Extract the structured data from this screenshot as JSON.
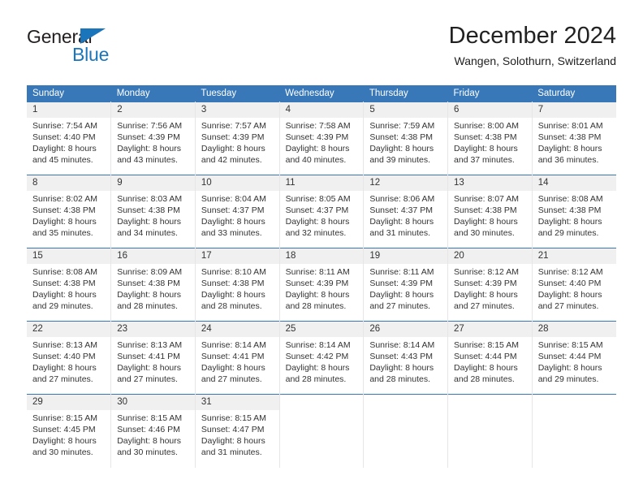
{
  "brand": {
    "name_dark": "General",
    "name_blue": "Blue",
    "accent_color": "#1b75bb"
  },
  "header": {
    "title": "December 2024",
    "subtitle": "Wangen, Solothurn, Switzerland"
  },
  "theme": {
    "header_row_color": "#3878b8",
    "daynum_band_color": "#f0f0f0",
    "text_color": "#333333"
  },
  "weekday_headers": [
    "Sunday",
    "Monday",
    "Tuesday",
    "Wednesday",
    "Thursday",
    "Friday",
    "Saturday"
  ],
  "weeks": [
    [
      {
        "day": "1",
        "sunrise": "Sunrise: 7:54 AM",
        "sunset": "Sunset: 4:40 PM",
        "daylight1": "Daylight: 8 hours",
        "daylight2": "and 45 minutes."
      },
      {
        "day": "2",
        "sunrise": "Sunrise: 7:56 AM",
        "sunset": "Sunset: 4:39 PM",
        "daylight1": "Daylight: 8 hours",
        "daylight2": "and 43 minutes."
      },
      {
        "day": "3",
        "sunrise": "Sunrise: 7:57 AM",
        "sunset": "Sunset: 4:39 PM",
        "daylight1": "Daylight: 8 hours",
        "daylight2": "and 42 minutes."
      },
      {
        "day": "4",
        "sunrise": "Sunrise: 7:58 AM",
        "sunset": "Sunset: 4:39 PM",
        "daylight1": "Daylight: 8 hours",
        "daylight2": "and 40 minutes."
      },
      {
        "day": "5",
        "sunrise": "Sunrise: 7:59 AM",
        "sunset": "Sunset: 4:38 PM",
        "daylight1": "Daylight: 8 hours",
        "daylight2": "and 39 minutes."
      },
      {
        "day": "6",
        "sunrise": "Sunrise: 8:00 AM",
        "sunset": "Sunset: 4:38 PM",
        "daylight1": "Daylight: 8 hours",
        "daylight2": "and 37 minutes."
      },
      {
        "day": "7",
        "sunrise": "Sunrise: 8:01 AM",
        "sunset": "Sunset: 4:38 PM",
        "daylight1": "Daylight: 8 hours",
        "daylight2": "and 36 minutes."
      }
    ],
    [
      {
        "day": "8",
        "sunrise": "Sunrise: 8:02 AM",
        "sunset": "Sunset: 4:38 PM",
        "daylight1": "Daylight: 8 hours",
        "daylight2": "and 35 minutes."
      },
      {
        "day": "9",
        "sunrise": "Sunrise: 8:03 AM",
        "sunset": "Sunset: 4:38 PM",
        "daylight1": "Daylight: 8 hours",
        "daylight2": "and 34 minutes."
      },
      {
        "day": "10",
        "sunrise": "Sunrise: 8:04 AM",
        "sunset": "Sunset: 4:37 PM",
        "daylight1": "Daylight: 8 hours",
        "daylight2": "and 33 minutes."
      },
      {
        "day": "11",
        "sunrise": "Sunrise: 8:05 AM",
        "sunset": "Sunset: 4:37 PM",
        "daylight1": "Daylight: 8 hours",
        "daylight2": "and 32 minutes."
      },
      {
        "day": "12",
        "sunrise": "Sunrise: 8:06 AM",
        "sunset": "Sunset: 4:37 PM",
        "daylight1": "Daylight: 8 hours",
        "daylight2": "and 31 minutes."
      },
      {
        "day": "13",
        "sunrise": "Sunrise: 8:07 AM",
        "sunset": "Sunset: 4:38 PM",
        "daylight1": "Daylight: 8 hours",
        "daylight2": "and 30 minutes."
      },
      {
        "day": "14",
        "sunrise": "Sunrise: 8:08 AM",
        "sunset": "Sunset: 4:38 PM",
        "daylight1": "Daylight: 8 hours",
        "daylight2": "and 29 minutes."
      }
    ],
    [
      {
        "day": "15",
        "sunrise": "Sunrise: 8:08 AM",
        "sunset": "Sunset: 4:38 PM",
        "daylight1": "Daylight: 8 hours",
        "daylight2": "and 29 minutes."
      },
      {
        "day": "16",
        "sunrise": "Sunrise: 8:09 AM",
        "sunset": "Sunset: 4:38 PM",
        "daylight1": "Daylight: 8 hours",
        "daylight2": "and 28 minutes."
      },
      {
        "day": "17",
        "sunrise": "Sunrise: 8:10 AM",
        "sunset": "Sunset: 4:38 PM",
        "daylight1": "Daylight: 8 hours",
        "daylight2": "and 28 minutes."
      },
      {
        "day": "18",
        "sunrise": "Sunrise: 8:11 AM",
        "sunset": "Sunset: 4:39 PM",
        "daylight1": "Daylight: 8 hours",
        "daylight2": "and 28 minutes."
      },
      {
        "day": "19",
        "sunrise": "Sunrise: 8:11 AM",
        "sunset": "Sunset: 4:39 PM",
        "daylight1": "Daylight: 8 hours",
        "daylight2": "and 27 minutes."
      },
      {
        "day": "20",
        "sunrise": "Sunrise: 8:12 AM",
        "sunset": "Sunset: 4:39 PM",
        "daylight1": "Daylight: 8 hours",
        "daylight2": "and 27 minutes."
      },
      {
        "day": "21",
        "sunrise": "Sunrise: 8:12 AM",
        "sunset": "Sunset: 4:40 PM",
        "daylight1": "Daylight: 8 hours",
        "daylight2": "and 27 minutes."
      }
    ],
    [
      {
        "day": "22",
        "sunrise": "Sunrise: 8:13 AM",
        "sunset": "Sunset: 4:40 PM",
        "daylight1": "Daylight: 8 hours",
        "daylight2": "and 27 minutes."
      },
      {
        "day": "23",
        "sunrise": "Sunrise: 8:13 AM",
        "sunset": "Sunset: 4:41 PM",
        "daylight1": "Daylight: 8 hours",
        "daylight2": "and 27 minutes."
      },
      {
        "day": "24",
        "sunrise": "Sunrise: 8:14 AM",
        "sunset": "Sunset: 4:41 PM",
        "daylight1": "Daylight: 8 hours",
        "daylight2": "and 27 minutes."
      },
      {
        "day": "25",
        "sunrise": "Sunrise: 8:14 AM",
        "sunset": "Sunset: 4:42 PM",
        "daylight1": "Daylight: 8 hours",
        "daylight2": "and 28 minutes."
      },
      {
        "day": "26",
        "sunrise": "Sunrise: 8:14 AM",
        "sunset": "Sunset: 4:43 PM",
        "daylight1": "Daylight: 8 hours",
        "daylight2": "and 28 minutes."
      },
      {
        "day": "27",
        "sunrise": "Sunrise: 8:15 AM",
        "sunset": "Sunset: 4:44 PM",
        "daylight1": "Daylight: 8 hours",
        "daylight2": "and 28 minutes."
      },
      {
        "day": "28",
        "sunrise": "Sunrise: 8:15 AM",
        "sunset": "Sunset: 4:44 PM",
        "daylight1": "Daylight: 8 hours",
        "daylight2": "and 29 minutes."
      }
    ],
    [
      {
        "day": "29",
        "sunrise": "Sunrise: 8:15 AM",
        "sunset": "Sunset: 4:45 PM",
        "daylight1": "Daylight: 8 hours",
        "daylight2": "and 30 minutes."
      },
      {
        "day": "30",
        "sunrise": "Sunrise: 8:15 AM",
        "sunset": "Sunset: 4:46 PM",
        "daylight1": "Daylight: 8 hours",
        "daylight2": "and 30 minutes."
      },
      {
        "day": "31",
        "sunrise": "Sunrise: 8:15 AM",
        "sunset": "Sunset: 4:47 PM",
        "daylight1": "Daylight: 8 hours",
        "daylight2": "and 31 minutes."
      },
      {
        "day": "",
        "sunrise": "",
        "sunset": "",
        "daylight1": "",
        "daylight2": ""
      },
      {
        "day": "",
        "sunrise": "",
        "sunset": "",
        "daylight1": "",
        "daylight2": ""
      },
      {
        "day": "",
        "sunrise": "",
        "sunset": "",
        "daylight1": "",
        "daylight2": ""
      },
      {
        "day": "",
        "sunrise": "",
        "sunset": "",
        "daylight1": "",
        "daylight2": ""
      }
    ]
  ]
}
